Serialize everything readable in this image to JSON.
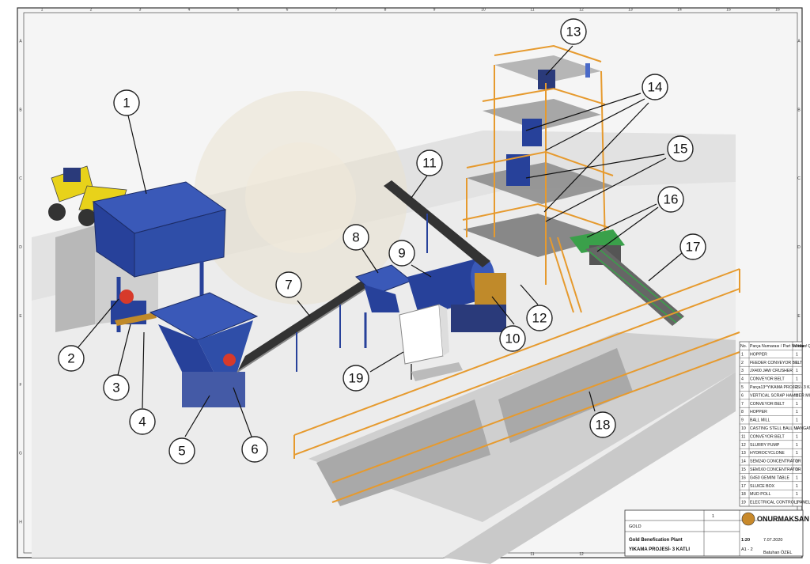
{
  "border": {
    "columns": [
      "1",
      "2",
      "3",
      "4",
      "5",
      "6",
      "7",
      "8",
      "9",
      "10",
      "11",
      "12",
      "13",
      "14",
      "15",
      "16"
    ],
    "rows": [
      "A",
      "B",
      "C",
      "D",
      "E",
      "F",
      "G",
      "H"
    ]
  },
  "callouts": [
    "1",
    "2",
    "3",
    "4",
    "5",
    "6",
    "7",
    "8",
    "9",
    "10",
    "11",
    "12",
    "13",
    "14",
    "15",
    "16",
    "17",
    "18",
    "19"
  ],
  "bom": {
    "headers": [
      "No.",
      "Parça Numarası / Part Number",
      "Miktar / Qty"
    ],
    "rows": [
      {
        "no": "1",
        "name": "HOPPER",
        "qty": "1"
      },
      {
        "no": "2",
        "name": "FEEDER CONVEYOR BELT",
        "qty": "1"
      },
      {
        "no": "3",
        "name": "JX400 JAW CRUSHER",
        "qty": "1"
      },
      {
        "no": "4",
        "name": "CONVEYOR BELT",
        "qty": "1"
      },
      {
        "no": "5",
        "name": "Parça13^YIKAMA PROJESİ- 3 KATLI",
        "qty": "1"
      },
      {
        "no": "6",
        "name": "VERTICAL SCRAP HAMMER MILL",
        "qty": "1"
      },
      {
        "no": "7",
        "name": "CONVEYOR BELT",
        "qty": "1"
      },
      {
        "no": "8",
        "name": "HOPPER",
        "qty": "1"
      },
      {
        "no": "9",
        "name": "BALL MILL",
        "qty": "1"
      },
      {
        "no": "10",
        "name": "CASTING STELL BALL MANGANESE ALLOY STEAL MILL",
        "qty": "1"
      },
      {
        "no": "11",
        "name": "CONVEYOR BELT",
        "qty": "1"
      },
      {
        "no": "12",
        "name": "SLURRY PUMP",
        "qty": "1"
      },
      {
        "no": "13",
        "name": "HYDROCYCLONE",
        "qty": "1"
      },
      {
        "no": "14",
        "name": "SEM240 CONCENTRATOR",
        "qty": "1"
      },
      {
        "no": "15",
        "name": "SEM160 CONCENTRATOR",
        "qty": "1"
      },
      {
        "no": "16",
        "name": "G450 GEMINI TABLE",
        "qty": "1"
      },
      {
        "no": "17",
        "name": "SLUICE BOX",
        "qty": "1"
      },
      {
        "no": "18",
        "name": "MUD POLL",
        "qty": "1"
      },
      {
        "no": "19",
        "name": "ELECTRICAL CONTROL PANEL",
        "qty": "1"
      }
    ]
  },
  "title_block": {
    "company": "ONURMAKSAN",
    "title_line1": "Gold Benefication Plant",
    "title_line2": "YIKAMA PROJESİ- 3 KATLI",
    "scale": "1:20",
    "sheet_size": "A1 - 2",
    "material": "GOLD",
    "sheet_no": "1",
    "drawer": "Batuhan ÖZEL",
    "date": "7.07.2020"
  },
  "colors": {
    "machine_blue": "#27419a",
    "railing_orange": "#e69a2e",
    "floor": "#ececec",
    "yellow": "#e8d21a"
  }
}
